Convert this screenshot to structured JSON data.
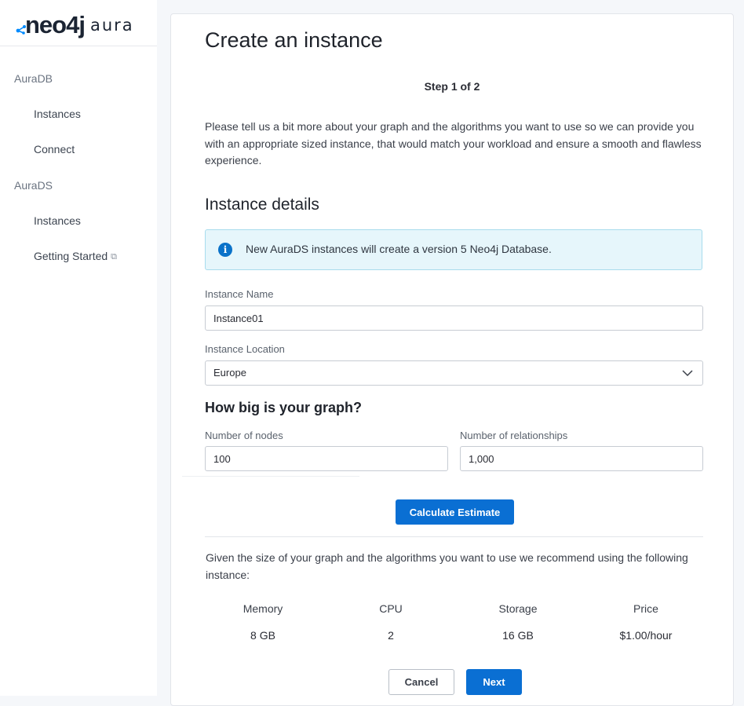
{
  "brand": {
    "logo_word": "neo4j",
    "logo_product": "aura"
  },
  "sidebar": {
    "groups": [
      {
        "label": "AuraDB",
        "items": [
          {
            "label": "Instances"
          },
          {
            "label": "Connect"
          }
        ]
      },
      {
        "label": "AuraDS",
        "items": [
          {
            "label": "Instances"
          },
          {
            "label": "Getting Started",
            "icon": "external-link-icon"
          }
        ]
      }
    ]
  },
  "main": {
    "title": "Create an instance",
    "step": "Step 1 of 2",
    "intro": "Please tell us a bit more about your graph and the algorithms you want to use so we can provide you with an appropriate sized instance, that would match your workload and ensure a smooth and flawless experience.",
    "section_title": "Instance details",
    "info": {
      "icon": "info-icon",
      "text": "New AuraDS instances will create a version 5 Neo4j Database."
    },
    "instance_name": {
      "label": "Instance Name",
      "value": "Instance01"
    },
    "instance_location": {
      "label": "Instance Location",
      "value": "Europe"
    },
    "graph_size_title": "How big is your graph?",
    "nodes": {
      "label": "Number of nodes",
      "value": "100"
    },
    "relationships": {
      "label": "Number of relationships",
      "value": "1,000"
    },
    "calculate_label": "Calculate Estimate",
    "recommendation": "Given the size of your graph and the algorithms you want to use we recommend using the following instance:",
    "specs": [
      {
        "label": "Memory",
        "value": "8 GB"
      },
      {
        "label": "CPU",
        "value": "2"
      },
      {
        "label": "Storage",
        "value": "16 GB"
      },
      {
        "label": "Price",
        "value": "$1.00/hour"
      }
    ],
    "cancel_label": "Cancel",
    "next_label": "Next"
  },
  "colors": {
    "primary": "#0a6fd3",
    "info_bg": "#e6f6fb",
    "info_border": "#a8dced",
    "sidebar_bg": "#ffffff",
    "page_bg": "#f5f7fa"
  }
}
